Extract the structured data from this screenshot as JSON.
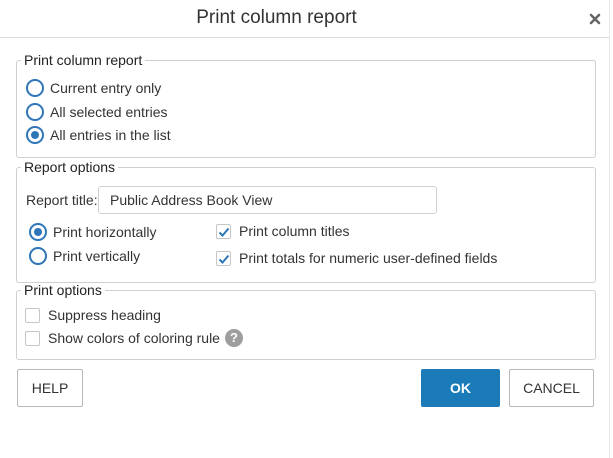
{
  "dialog": {
    "title": "Print column report",
    "close_icon": "close-icon"
  },
  "scope_group": {
    "legend": "Print column report",
    "options": [
      {
        "label": "Current entry only",
        "selected": false
      },
      {
        "label": "All selected entries",
        "selected": false
      },
      {
        "label": "All entries in the list",
        "selected": true
      }
    ]
  },
  "report_options": {
    "legend": "Report options",
    "title_label": "Report title:",
    "title_value": "Public Address Book View",
    "orientation": [
      {
        "label": "Print horizontally",
        "selected": true
      },
      {
        "label": "Print vertically",
        "selected": false
      }
    ],
    "checks": [
      {
        "label": "Print column titles",
        "checked": true
      },
      {
        "label": "Print totals for numeric user-defined fields",
        "checked": true
      }
    ]
  },
  "print_options": {
    "legend": "Print options",
    "checks": [
      {
        "label": "Suppress heading",
        "checked": false
      },
      {
        "label": "Show colors of coloring rule",
        "checked": false
      }
    ],
    "help_glyph": "?"
  },
  "buttons": {
    "help": "HELP",
    "ok": "OK",
    "cancel": "CANCEL"
  },
  "colors": {
    "accent": "#2e76b8",
    "primary_button": "#1a7bb8",
    "border": "#cfcfcf",
    "help_icon": "#9e9e9e"
  }
}
